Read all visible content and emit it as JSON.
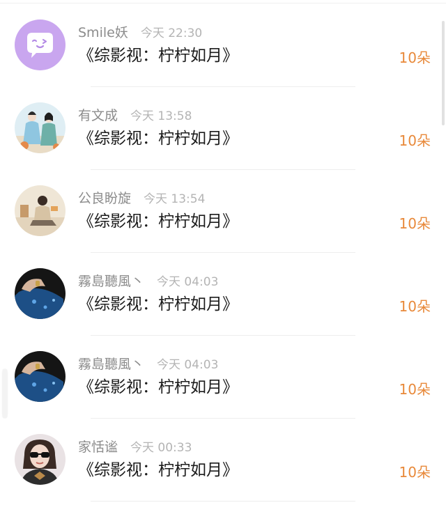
{
  "records": [
    {
      "user": "Smile妖",
      "time": "今天 22:30",
      "book": "《综影视：柠柠如月》",
      "gift": "10朵",
      "avatar": "chat-bubble-face-icon"
    },
    {
      "user": "有文成",
      "time": "今天 13:58",
      "book": "《综影视：柠柠如月》",
      "gift": "10朵",
      "avatar": "ancient-costume-couple-avatar"
    },
    {
      "user": "公良盼旋",
      "time": "今天 13:54",
      "book": "《综影视：柠柠如月》",
      "gift": "10朵",
      "avatar": "seated-person-avatar"
    },
    {
      "user": "霧島聽風丶",
      "time": "今天 04:03",
      "book": "《综影视：柠柠如月》",
      "gift": "10朵",
      "avatar": "hand-blue-cloth-avatar"
    },
    {
      "user": "霧島聽風丶",
      "time": "今天 04:03",
      "book": "《综影视：柠柠如月》",
      "gift": "10朵",
      "avatar": "hand-blue-cloth-avatar"
    },
    {
      "user": "家恬谧",
      "time": "今天 00:33",
      "book": "《综影视：柠柠如月》",
      "gift": "10朵",
      "avatar": "woman-sunglasses-avatar"
    }
  ],
  "colors": {
    "gift_orange": "#e8893a",
    "avatar_lavender": "#c9a6ef",
    "username_gray": "#8c8c8c",
    "time_gray": "#b4b4b4"
  }
}
